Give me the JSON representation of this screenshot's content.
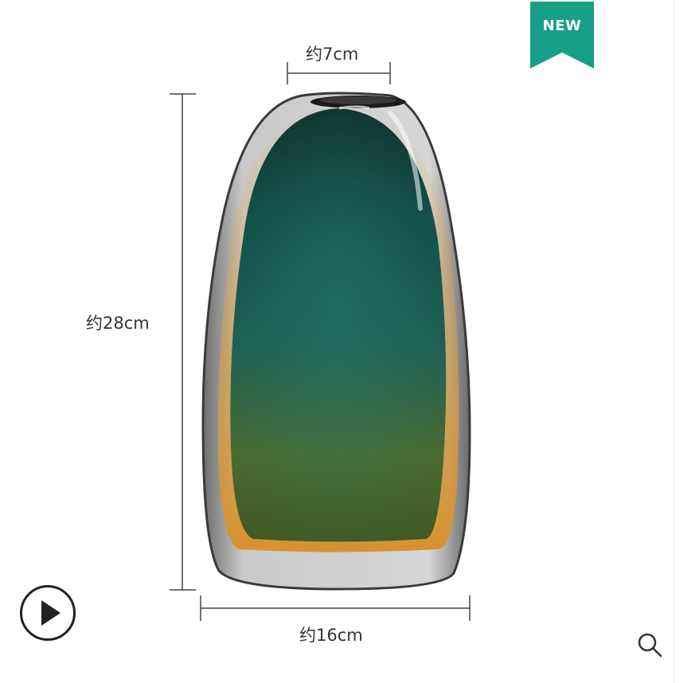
{
  "badge": {
    "label": "NEW",
    "color": "#169f86"
  },
  "dimensions": {
    "top_width": "约7cm",
    "height": "约28cm",
    "bottom_width": "约16cm"
  },
  "controls": {
    "play_icon": "play-icon",
    "zoom_icon": "zoom-in-icon"
  }
}
